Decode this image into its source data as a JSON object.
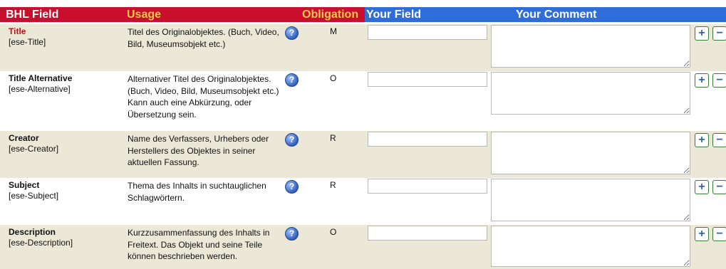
{
  "header": {
    "bhl_field": "BHL Field",
    "usage": "Usage",
    "obligation": "Obligation",
    "your_field": "Your Field",
    "your_comment": "Your Comment"
  },
  "rows": [
    {
      "name": "Title",
      "code": "[ese-Title]",
      "usage": "Titel des Originalobjektes. (Buch, Video, Bild, Museumsobjekt etc.)",
      "obligation": "M",
      "field_value": "",
      "comment_value": ""
    },
    {
      "name": "Title Alternative",
      "code": "[ese-Alternative]",
      "usage": "Alternativer Titel des Originalobjektes. (Buch, Video, Bild, Museumsobjekt etc.) Kann auch eine Abkürzung, oder Übersetzung sein.",
      "obligation": "O",
      "field_value": "",
      "comment_value": ""
    },
    {
      "name": "Creator",
      "code": "[ese-Creator]",
      "usage": "Name des Verfassers, Urhebers oder Herstellers des Objektes in seiner aktuellen Fassung.",
      "obligation": "R",
      "field_value": "",
      "comment_value": ""
    },
    {
      "name": "Subject",
      "code": "[ese-Subject]",
      "usage": "Thema des Inhalts in suchtauglichen Schlagwörtern.",
      "obligation": "R",
      "field_value": "",
      "comment_value": ""
    },
    {
      "name": "Description",
      "code": "[ese-Description]",
      "usage": "Kurzzusammenfassung des Inhalts in Freitext. Das Objekt und seine Teile können beschrieben werden.",
      "obligation": "O",
      "field_value": "",
      "comment_value": ""
    }
  ],
  "icons": {
    "help": "question-icon",
    "add": "plus-icon",
    "remove": "minus-icon"
  },
  "colors": {
    "header_red": "#c8102e",
    "header_blue": "#2f6ed8",
    "header_gold": "#f4c94a",
    "row_alt": "#ece8d7"
  }
}
